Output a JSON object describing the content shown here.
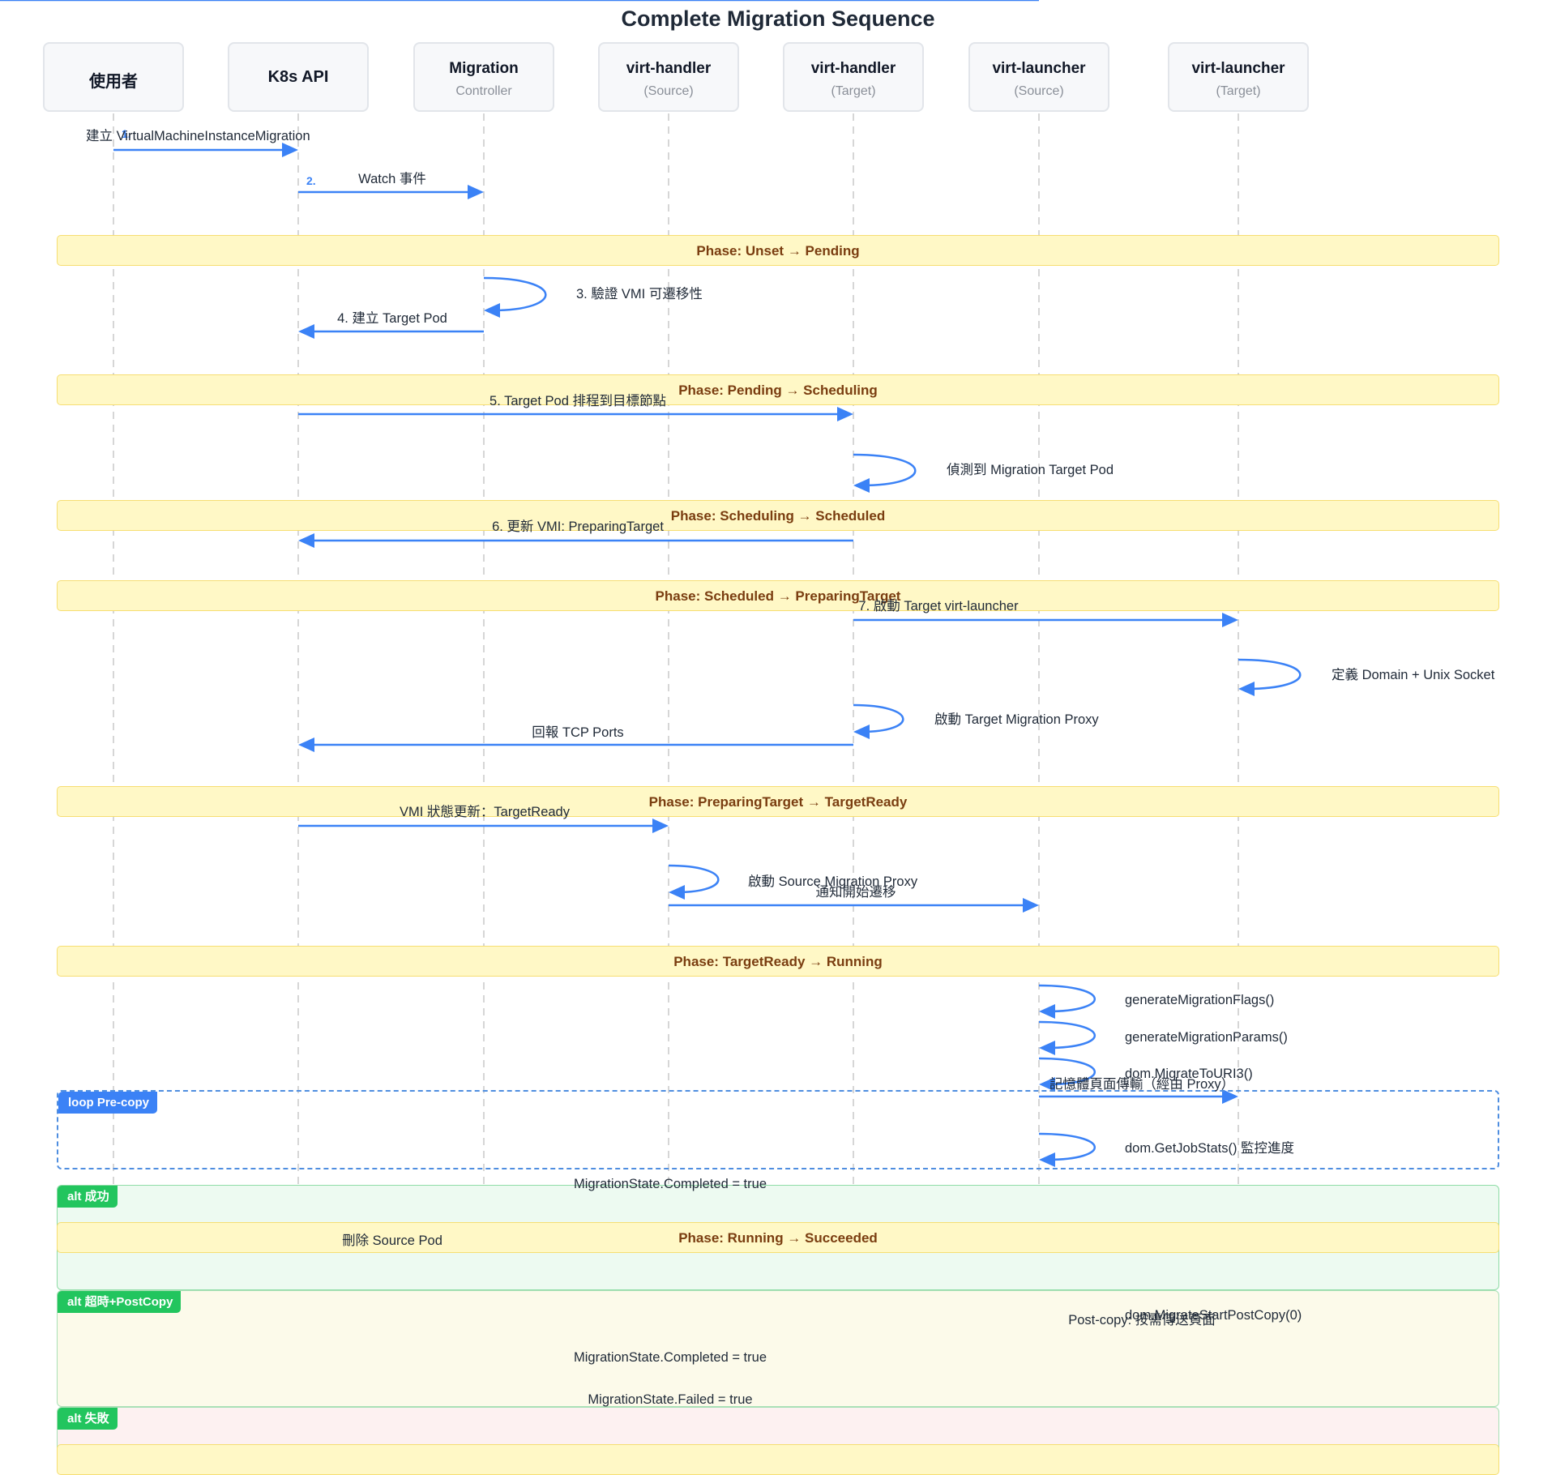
{
  "title": "Complete Migration Sequence",
  "participants": [
    {
      "name": "使用者",
      "sub": ""
    },
    {
      "name": "K8s API",
      "sub": ""
    },
    {
      "name": "Migration",
      "sub": "Controller"
    },
    {
      "name": "virt-handler",
      "sub": "(Source)"
    },
    {
      "name": "virt-handler",
      "sub": "(Target)"
    },
    {
      "name": "virt-launcher",
      "sub": "(Source)"
    },
    {
      "name": "virt-launcher",
      "sub": "(Target)"
    }
  ],
  "phases": [
    "Phase: Unset → Pending",
    "Phase: Pending → Scheduling",
    "Phase: Scheduling → Scheduled",
    "Phase: Scheduled → PreparingTarget",
    "Phase: PreparingTarget → TargetReady",
    "Phase: TargetReady → Running",
    "Phase: Running → Succeeded"
  ],
  "frames": {
    "loop": "loop Pre-copy",
    "success": "alt 成功",
    "timeout": "alt 超時+PostCopy",
    "failure": "alt 失敗"
  },
  "step_numbers": {
    "s1": "1.",
    "s2": "2."
  },
  "messages": [
    "建立 VirtualMachineInstanceMigration",
    "Watch 事件",
    "3. 驗證 VMI 可遷移性",
    "4. 建立 Target Pod",
    "5. Target Pod 排程到目標節點",
    "偵測到 Migration Target Pod",
    "6. 更新 VMI: PreparingTarget",
    "7. 啟動 Target virt-launcher",
    "定義 Domain + Unix Socket",
    "啟動 Target Migration Proxy",
    "回報 TCP Ports",
    "VMI 狀態更新：TargetReady",
    "啟動 Source Migration Proxy",
    "通知開始遷移",
    "generateMigrationFlags()",
    "generateMigrationParams()",
    "dom.MigrateToURI3()",
    "記憶體頁面傳輸（經由 Proxy）",
    "dom.GetJobStats() 監控進度",
    "MigrationState.Completed = true",
    "刪除 Source Pod",
    "dom.MigrateStartPostCopy(0)",
    "Post-copy: 按需傳送頁面",
    "MigrationState.Completed = true",
    "MigrationState.Failed = true"
  ],
  "colors": {
    "arrow": "#3b82f6",
    "lifeline": "#d6d6d6",
    "phase_fill": "#fff8c6",
    "phase_text": "#7a3d10",
    "tag_green": "#22c55e",
    "tag_blue": "#3b82f6"
  }
}
